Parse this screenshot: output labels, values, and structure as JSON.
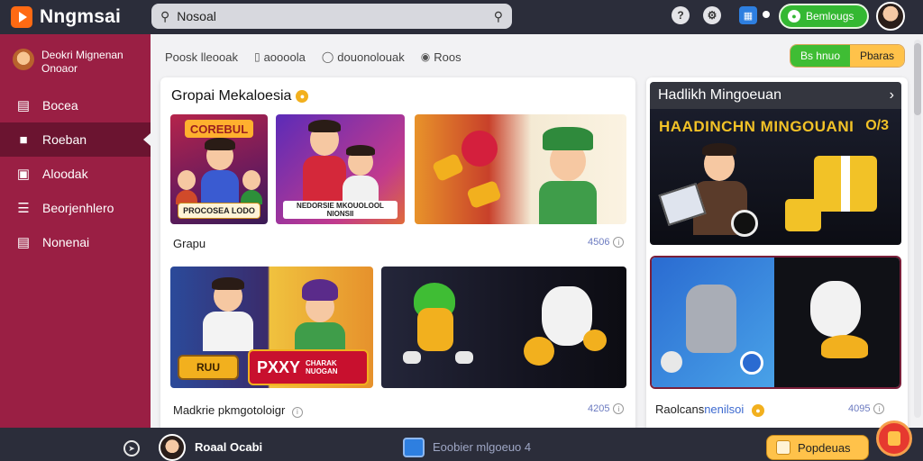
{
  "app": {
    "title": "Nngmsai"
  },
  "search": {
    "value": "Nosoal"
  },
  "top": {
    "help": "?",
    "cta_label": "Bemlougs"
  },
  "sidebar": {
    "user_name": "Deokri Mignenan Onoaor",
    "items": [
      {
        "label": "Bocea"
      },
      {
        "label": "Roeban"
      },
      {
        "label": "Aloodak"
      },
      {
        "label": "Beorjenhlero"
      },
      {
        "label": "Nonenai"
      }
    ]
  },
  "tabs": [
    {
      "label": "Poosk lleooak"
    },
    {
      "label": "aoooola"
    },
    {
      "label": "douonolouak"
    },
    {
      "label": "Roos"
    }
  ],
  "segmented": {
    "left": "Bs hnuo",
    "right": "Pbaras"
  },
  "main": {
    "title": "Gropai Mekaloesia",
    "row1_label": "Grapu",
    "row1_count": "4506",
    "row2_label": "Madkrie pkmgotoloigr",
    "row2_count": "4205",
    "thumbs": {
      "t1_banner": "COREBUL",
      "t1_caption": "PROCOSEA LODO",
      "t2_caption": "NEDORSIE MKOUOLOOL NIONSII",
      "t4_button": "RUU",
      "t4_banner": "PXXY",
      "t4_sub": "CHARAK NUOGAN"
    }
  },
  "right": {
    "title": "Hadlikh Mingoeuan",
    "banner": "HAADINCHN MINGOUANI",
    "banner_number": "O/3",
    "label_plain": "Raolcans",
    "label_accent": "nenilsoi",
    "count": "4095"
  },
  "bottom": {
    "user_name": "Roaal Ocabi",
    "status": "Eoobier mlgoeuo 4",
    "button": "Popdeuas"
  },
  "colors": {
    "sidebar": "#9a1f44",
    "sidebar_active": "#6b1430",
    "topbar": "#2b2d3a",
    "accent_green": "#34b832",
    "accent_yellow": "#ffc24a",
    "accent_orange": "#ff6a13"
  }
}
